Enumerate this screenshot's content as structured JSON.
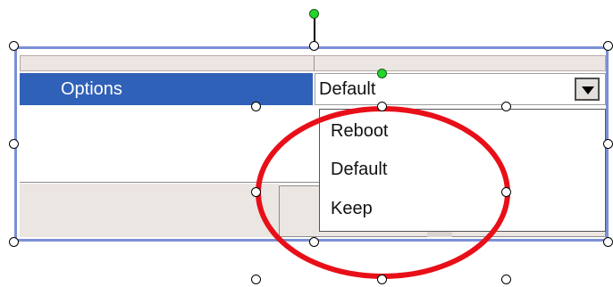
{
  "property_row": {
    "name": "Options",
    "value": "Default"
  },
  "dropdown": {
    "options": [
      "Reboot",
      "Default",
      "Keep"
    ]
  },
  "colors": {
    "selected_row": "#3061b8",
    "frame_border": "#7c8fd6",
    "annotation": "#e80f18",
    "rotate_handle": "#22d62a"
  },
  "icons": {
    "dropdown_arrow": "chevron-down-icon"
  }
}
